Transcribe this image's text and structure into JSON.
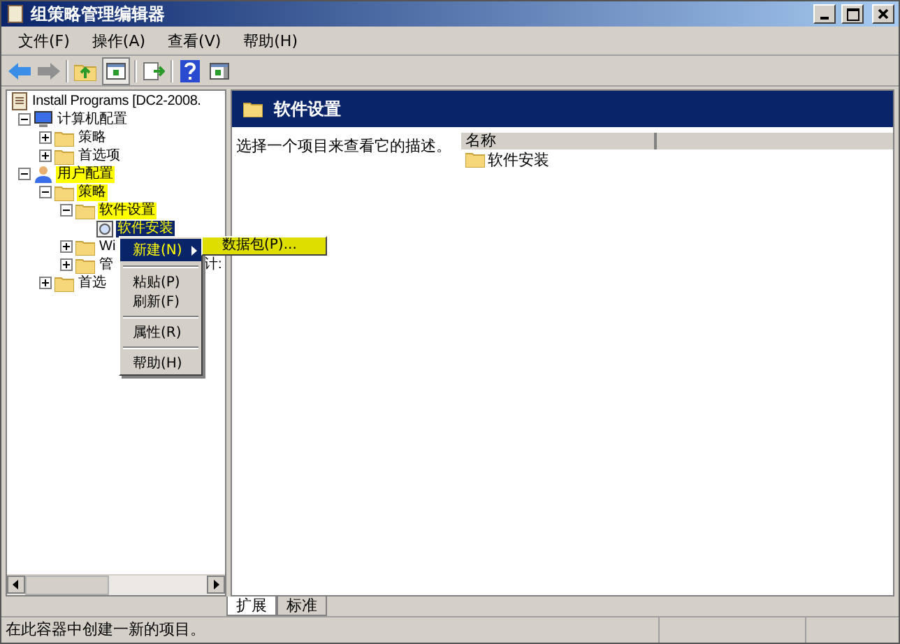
{
  "window": {
    "title": "组策略管理编辑器"
  },
  "menu_bar": [
    "文件(F)",
    "操作(A)",
    "查看(V)",
    "帮助(H)"
  ],
  "tree": {
    "items": [
      {
        "label": "Install Programs [DC2-2008.",
        "kind": "document",
        "children": [
          {
            "label": "计算机配置",
            "kind": "computer",
            "expanded": true,
            "highlighted": false,
            "selected": false,
            "children": [
              {
                "label": "策略",
                "kind": "folder",
                "expanded": false,
                "highlighted": false,
                "selected": false
              },
              {
                "label": "首选项",
                "kind": "folder",
                "expanded": false,
                "highlighted": false,
                "selected": false
              }
            ]
          },
          {
            "label": "用户配置",
            "kind": "user",
            "expanded": true,
            "highlighted": true,
            "selected": false,
            "children": [
              {
                "label": "策略",
                "kind": "folder",
                "expanded": true,
                "highlighted": true,
                "selected": false,
                "children": [
                  {
                    "label": "软件设置",
                    "kind": "folder",
                    "expanded": true,
                    "highlighted": true,
                    "selected": false,
                    "children": [
                      {
                        "label": "软件安装",
                        "kind": "package",
                        "highlighted": true,
                        "selected": true
                      }
                    ]
                  },
                  {
                    "label": "Wi",
                    "kind": "folder",
                    "expanded": false,
                    "highlighted": false,
                    "selected": false
                  },
                  {
                    "label": "管",
                    "tail": "计:",
                    "kind": "folder",
                    "expanded": false,
                    "highlighted": false,
                    "selected": false
                  }
                ]
              },
              {
                "label": "首选",
                "kind": "folder",
                "expanded": false,
                "highlighted": false,
                "selected": false
              }
            ]
          }
        ]
      }
    ]
  },
  "context_menu": {
    "items": [
      {
        "kind": "item",
        "label": "新建(N)",
        "submenu": true,
        "selected": true
      },
      {
        "kind": "separator"
      },
      {
        "kind": "item",
        "label": "粘贴(P)",
        "submenu": false,
        "selected": false
      },
      {
        "kind": "item",
        "label": "刷新(F)",
        "submenu": false,
        "selected": false
      },
      {
        "kind": "separator"
      },
      {
        "kind": "item",
        "label": "属性(R)",
        "submenu": false,
        "selected": false
      },
      {
        "kind": "separator"
      },
      {
        "kind": "item",
        "label": "帮助(H)",
        "submenu": false,
        "selected": false
      }
    ],
    "submenu": {
      "items": [
        {
          "label": "数据包(P)...",
          "highlighted": true
        }
      ]
    }
  },
  "details": {
    "title": "软件设置",
    "description": "选择一个项目来查看它的描述。",
    "columns": [
      "名称"
    ],
    "rows": [
      {
        "name": "软件安装"
      }
    ]
  },
  "view_tabs": [
    {
      "label": "扩展",
      "selected": true
    },
    {
      "label": "标准",
      "selected": false
    }
  ],
  "status_bar": "在此容器中创建一新的项目。"
}
